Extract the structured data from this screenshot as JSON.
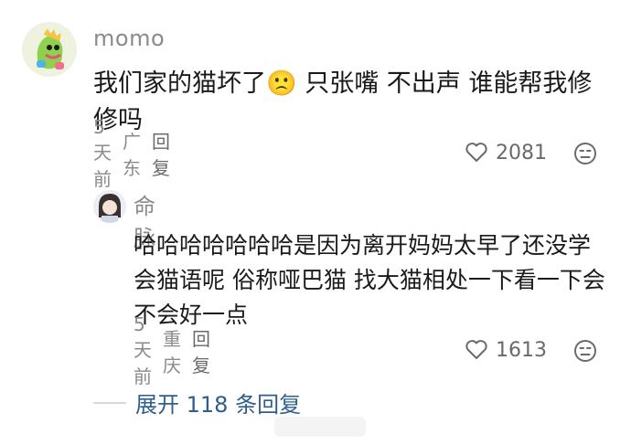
{
  "comments": [
    {
      "username": "momo",
      "text": "我们家的猫坏了🙁 只张嘴 不出声 谁能帮我修修吗",
      "time": "5天前",
      "location": "广东",
      "reply_label": "回复",
      "likes": "2081"
    },
    {
      "username": "命脉",
      "text": "哈哈哈哈哈哈哈是因为离开妈妈太早了还没学会猫语呢 俗称哑巴猫 找大猫相处一下看一下会不会好一点",
      "time": "5天前",
      "location": "重庆",
      "reply_label": "回复",
      "likes": "1613"
    }
  ],
  "expand_label": "展开 118 条回复",
  "colors": {
    "muted_text": "#8a8a8a",
    "link": "#2f5e8c",
    "body": "#1a1a1a"
  },
  "icons": [
    "avatar-dinosaur",
    "avatar-girl",
    "heart-icon",
    "dislike-face-icon"
  ]
}
